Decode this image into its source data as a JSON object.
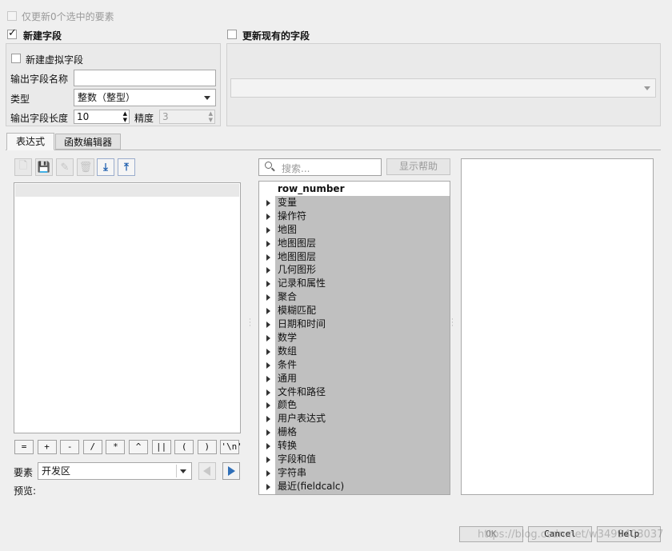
{
  "top": {
    "only_selected_label": "仅更新0个选中的要素"
  },
  "new_field": {
    "title": "新建字段",
    "virtual_label": "新建虚拟字段",
    "name_label": "输出字段名称",
    "name_value": "",
    "type_label": "类型",
    "type_value": "整数（整型）",
    "length_label": "输出字段长度",
    "length_value": "10",
    "precision_label": "精度",
    "precision_value": "3"
  },
  "update_field": {
    "title": "更新现有的字段",
    "combo_value": ""
  },
  "tabs": [
    {
      "label": "表达式"
    },
    {
      "label": "函数编辑器"
    }
  ],
  "toolbar_icons": [
    "new-file-icon",
    "save-icon",
    "edit-icon",
    "delete-icon",
    "load-icon",
    "export-icon"
  ],
  "search": {
    "placeholder": "搜索...",
    "help_button": "显示帮助"
  },
  "operators": [
    "=",
    "+",
    "-",
    "/",
    "*",
    "^",
    "||",
    "(",
    ")",
    "'\\n'"
  ],
  "feature": {
    "label": "要素",
    "value": "开发区"
  },
  "preview": {
    "label": "预览:"
  },
  "function_tree": [
    {
      "label": "row_number",
      "expandable": false
    },
    {
      "label": "变量",
      "expandable": true
    },
    {
      "label": "操作符",
      "expandable": true
    },
    {
      "label": "地图",
      "expandable": true
    },
    {
      "label": "地图图层",
      "expandable": true
    },
    {
      "label": "地图图层",
      "expandable": true
    },
    {
      "label": "几何图形",
      "expandable": true
    },
    {
      "label": "记录和属性",
      "expandable": true
    },
    {
      "label": "聚合",
      "expandable": true
    },
    {
      "label": "模糊匹配",
      "expandable": true
    },
    {
      "label": "日期和时间",
      "expandable": true
    },
    {
      "label": "数学",
      "expandable": true
    },
    {
      "label": "数组",
      "expandable": true
    },
    {
      "label": "条件",
      "expandable": true
    },
    {
      "label": "通用",
      "expandable": true
    },
    {
      "label": "文件和路径",
      "expandable": true
    },
    {
      "label": "颜色",
      "expandable": true
    },
    {
      "label": "用户表达式",
      "expandable": true
    },
    {
      "label": "栅格",
      "expandable": true
    },
    {
      "label": "转换",
      "expandable": true
    },
    {
      "label": "字段和值",
      "expandable": true
    },
    {
      "label": "字符串",
      "expandable": true
    },
    {
      "label": "最近(fieldcalc)",
      "expandable": true
    }
  ],
  "buttons": {
    "ok": "OK",
    "cancel": "Cancel",
    "help": "Help"
  },
  "watermark": "https://blog.csdn.net/w3499403037"
}
